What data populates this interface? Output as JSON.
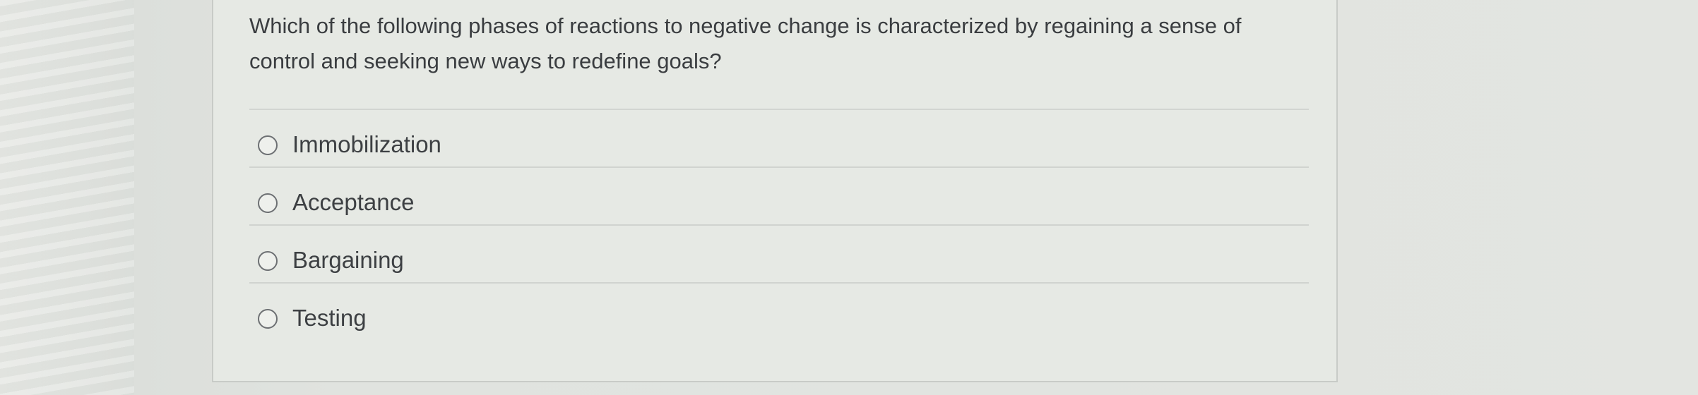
{
  "question": {
    "text": "Which of the following phases of reactions to negative change is characterized by regaining a sense of control and seeking new ways to redefine goals?"
  },
  "options": [
    {
      "label": "Immobilization",
      "selected": false
    },
    {
      "label": "Acceptance",
      "selected": false
    },
    {
      "label": "Bargaining",
      "selected": false
    },
    {
      "label": "Testing",
      "selected": false
    }
  ],
  "colors": {
    "text": "#3a3d40",
    "radio_border": "#6d7073",
    "divider": "#d0d3cf",
    "card_border": "#c8cbc7"
  }
}
